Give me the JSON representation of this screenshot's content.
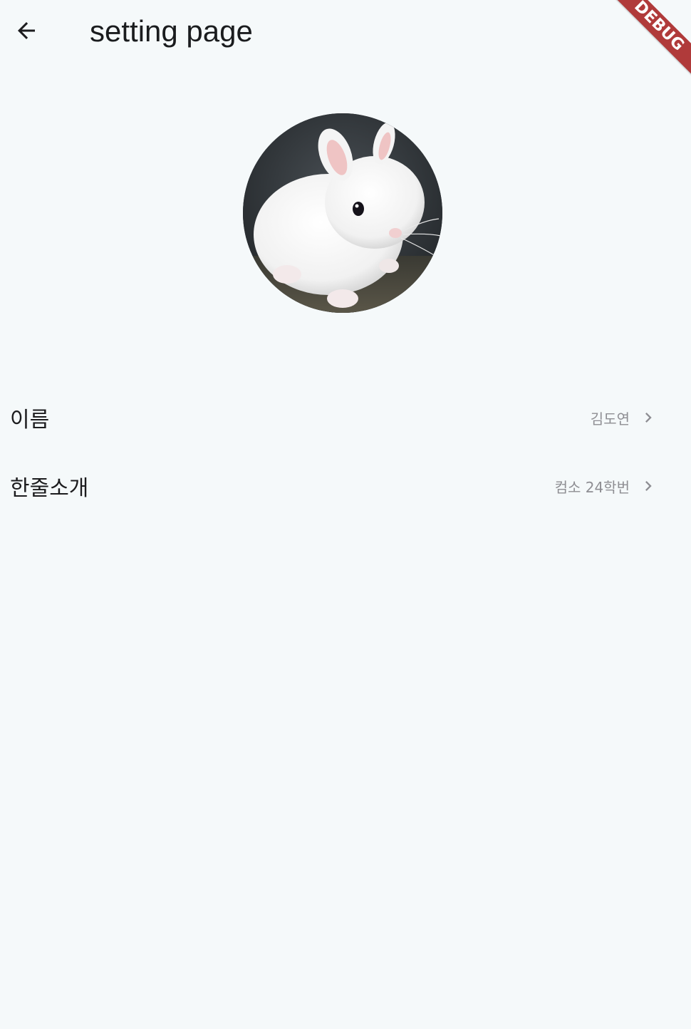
{
  "app_bar": {
    "title": "setting page",
    "back_icon": "arrow-left-icon"
  },
  "debug_banner": {
    "label": "DEBUG",
    "color": "#b03a3a"
  },
  "profile": {
    "avatar_subject": "white-rabbit-photo"
  },
  "settings": {
    "items": [
      {
        "label": "이름",
        "value": "김도연",
        "icon": "chevron-right-icon"
      },
      {
        "label": "한줄소개",
        "value": "컴소 24학번",
        "icon": "chevron-right-icon"
      }
    ]
  },
  "colors": {
    "background": "#f5f9fa",
    "text_primary": "#1c1c1e",
    "text_secondary": "#8e8e93"
  }
}
